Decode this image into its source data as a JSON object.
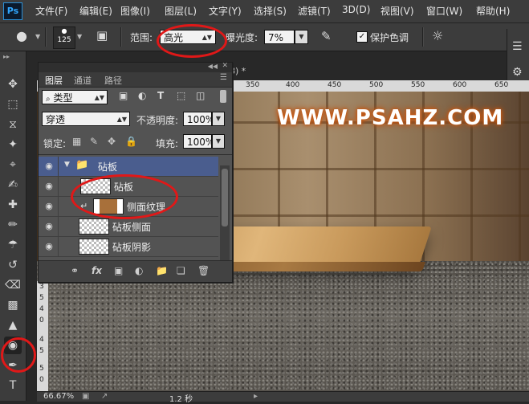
{
  "app": {
    "logo": "Ps"
  },
  "menu": [
    "文件(F)",
    "编辑(E)",
    "图像(I)",
    "图层(L)",
    "文字(Y)",
    "选择(S)",
    "滤镜(T)",
    "3D(D)",
    "视图(V)",
    "窗口(W)",
    "帮助(H)"
  ],
  "options": {
    "brush_size": "125",
    "range_label": "范围:",
    "range_value": "高光",
    "exposure_label": "曝光度:",
    "exposure_value": "7%",
    "protect_tones_label": "保护色调",
    "protect_tones_checked": true
  },
  "document": {
    "tab_suffix": "8) *",
    "watermark": "WWW.PSAHZ.COM",
    "ruler_top": [
      "350",
      "400",
      "450",
      "500",
      "550",
      "600",
      "650"
    ],
    "ruler_left": [
      "3",
      "5",
      "4",
      "0",
      "4",
      "5",
      "5",
      "0"
    ]
  },
  "layers_panel": {
    "tabs": [
      "图层",
      "通道",
      "路径"
    ],
    "filter_kind": "类型",
    "blend_mode": "穿透",
    "opacity_label": "不透明度:",
    "opacity_value": "100%",
    "lock_label": "锁定:",
    "fill_label": "填充:",
    "fill_value": "100%",
    "layers": [
      {
        "name": "砧板",
        "type": "group",
        "selected": true
      },
      {
        "name": "砧板",
        "type": "layer"
      },
      {
        "name": "侧面纹理",
        "type": "clipped-layer"
      },
      {
        "name": "砧板侧面",
        "type": "layer"
      },
      {
        "name": "砧板阴影",
        "type": "layer"
      }
    ]
  },
  "status": {
    "zoom": "66.67%",
    "timing": "1.2 秒"
  }
}
